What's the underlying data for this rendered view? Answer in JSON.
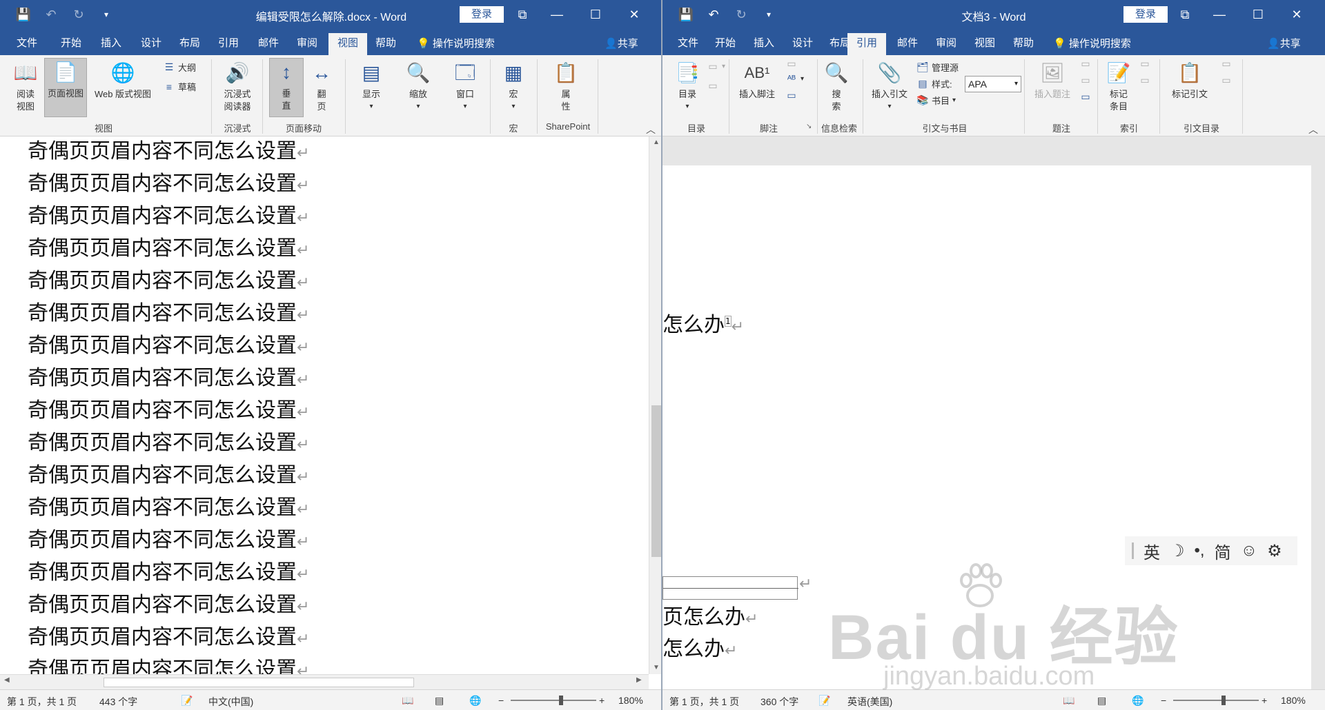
{
  "left_window": {
    "title": "编辑受限怎么解除.docx  -  Word",
    "login": "登录",
    "tabs": [
      "文件",
      "开始",
      "插入",
      "设计",
      "布局",
      "引用",
      "邮件",
      "审阅",
      "视图",
      "帮助"
    ],
    "active_tab": "视图",
    "tell_me": "操作说明搜索",
    "share": "共享",
    "ribbon": {
      "read_mode": "阅读\n视图",
      "read_mode_l1": "阅读",
      "read_mode_l2": "视图",
      "print_layout": "页面视图",
      "web_layout": "Web 版式视图",
      "outline": "大纲",
      "draft": "草稿",
      "group_views": "视图",
      "immersive_l1": "沉浸式",
      "immersive_l2": "阅读器",
      "group_immersive": "沉浸式",
      "vertical_l1": "垂",
      "vertical_l2": "直",
      "side_l1": "翻",
      "side_l2": "页",
      "group_page_move": "页面移动",
      "show": "显示",
      "zoom": "缩放",
      "window": "窗口",
      "macros": "宏",
      "group_macros": "宏",
      "properties_l1": "属",
      "properties_l2": "性",
      "group_sharepoint": "SharePoint"
    },
    "document_lines": [
      "奇偶页页眉内容不同怎么设置",
      "奇偶页页眉内容不同怎么设置",
      "奇偶页页眉内容不同怎么设置",
      "奇偶页页眉内容不同怎么设置",
      "奇偶页页眉内容不同怎么设置",
      "奇偶页页眉内容不同怎么设置",
      "奇偶页页眉内容不同怎么设置",
      "奇偶页页眉内容不同怎么设置",
      "奇偶页页眉内容不同怎么设置",
      "奇偶页页眉内容不同怎么设置",
      "奇偶页页眉内容不同怎么设置",
      "奇偶页页眉内容不同怎么设置",
      "奇偶页页眉内容不同怎么设置",
      "奇偶页页眉内容不同怎么设置",
      "奇偶页页眉内容不同怎么设置",
      "奇偶页页眉内容不同怎么设置",
      "奇偶页页眉内容不同怎么设置"
    ],
    "status": {
      "page": "第 1 页，共 1 页",
      "words": "443 个字",
      "language": "中文(中国)",
      "zoom": "180%"
    }
  },
  "right_window": {
    "title": "文档3  -  Word",
    "login": "登录",
    "tabs": [
      "文件",
      "开始",
      "插入",
      "设计",
      "布局",
      "引用",
      "邮件",
      "审阅",
      "视图",
      "帮助"
    ],
    "active_tab": "引用",
    "tell_me": "操作说明搜索",
    "share": "共享",
    "ribbon": {
      "toc": "目录",
      "group_toc": "目录",
      "insert_footnote": "插入脚注",
      "group_footnotes": "脚注",
      "search_l1": "搜",
      "search_l2": "索",
      "group_research": "信息检索",
      "insert_citation": "插入引文",
      "manage_sources": "管理源",
      "style_label": "样式:",
      "style_value": "APA",
      "bibliography": "书目",
      "group_citations": "引文与书目",
      "insert_caption": "插入题注",
      "group_captions": "题注",
      "mark_entry_l1": "标记",
      "mark_entry_l2": "条目",
      "group_index": "索引",
      "mark_citation": "标记引文",
      "group_toa": "引文目录"
    },
    "document_lines": [
      "怎么办",
      "页怎么办",
      "怎么办"
    ],
    "footnote_ref": "1",
    "ime_toolbar": [
      "英",
      "☽",
      "•,",
      "简",
      "☺",
      "⚙"
    ],
    "watermark": {
      "brand": "Bai du 经验",
      "url": "jingyan.baidu.com"
    },
    "status": {
      "page": "第 1 页，共 1 页",
      "words": "360 个字",
      "language": "英语(美国)",
      "zoom": "180%"
    }
  },
  "colors": {
    "title_bar": "#2b579a",
    "ribbon_bg": "#f3f3f3",
    "status_bg": "#f3f3f3"
  }
}
